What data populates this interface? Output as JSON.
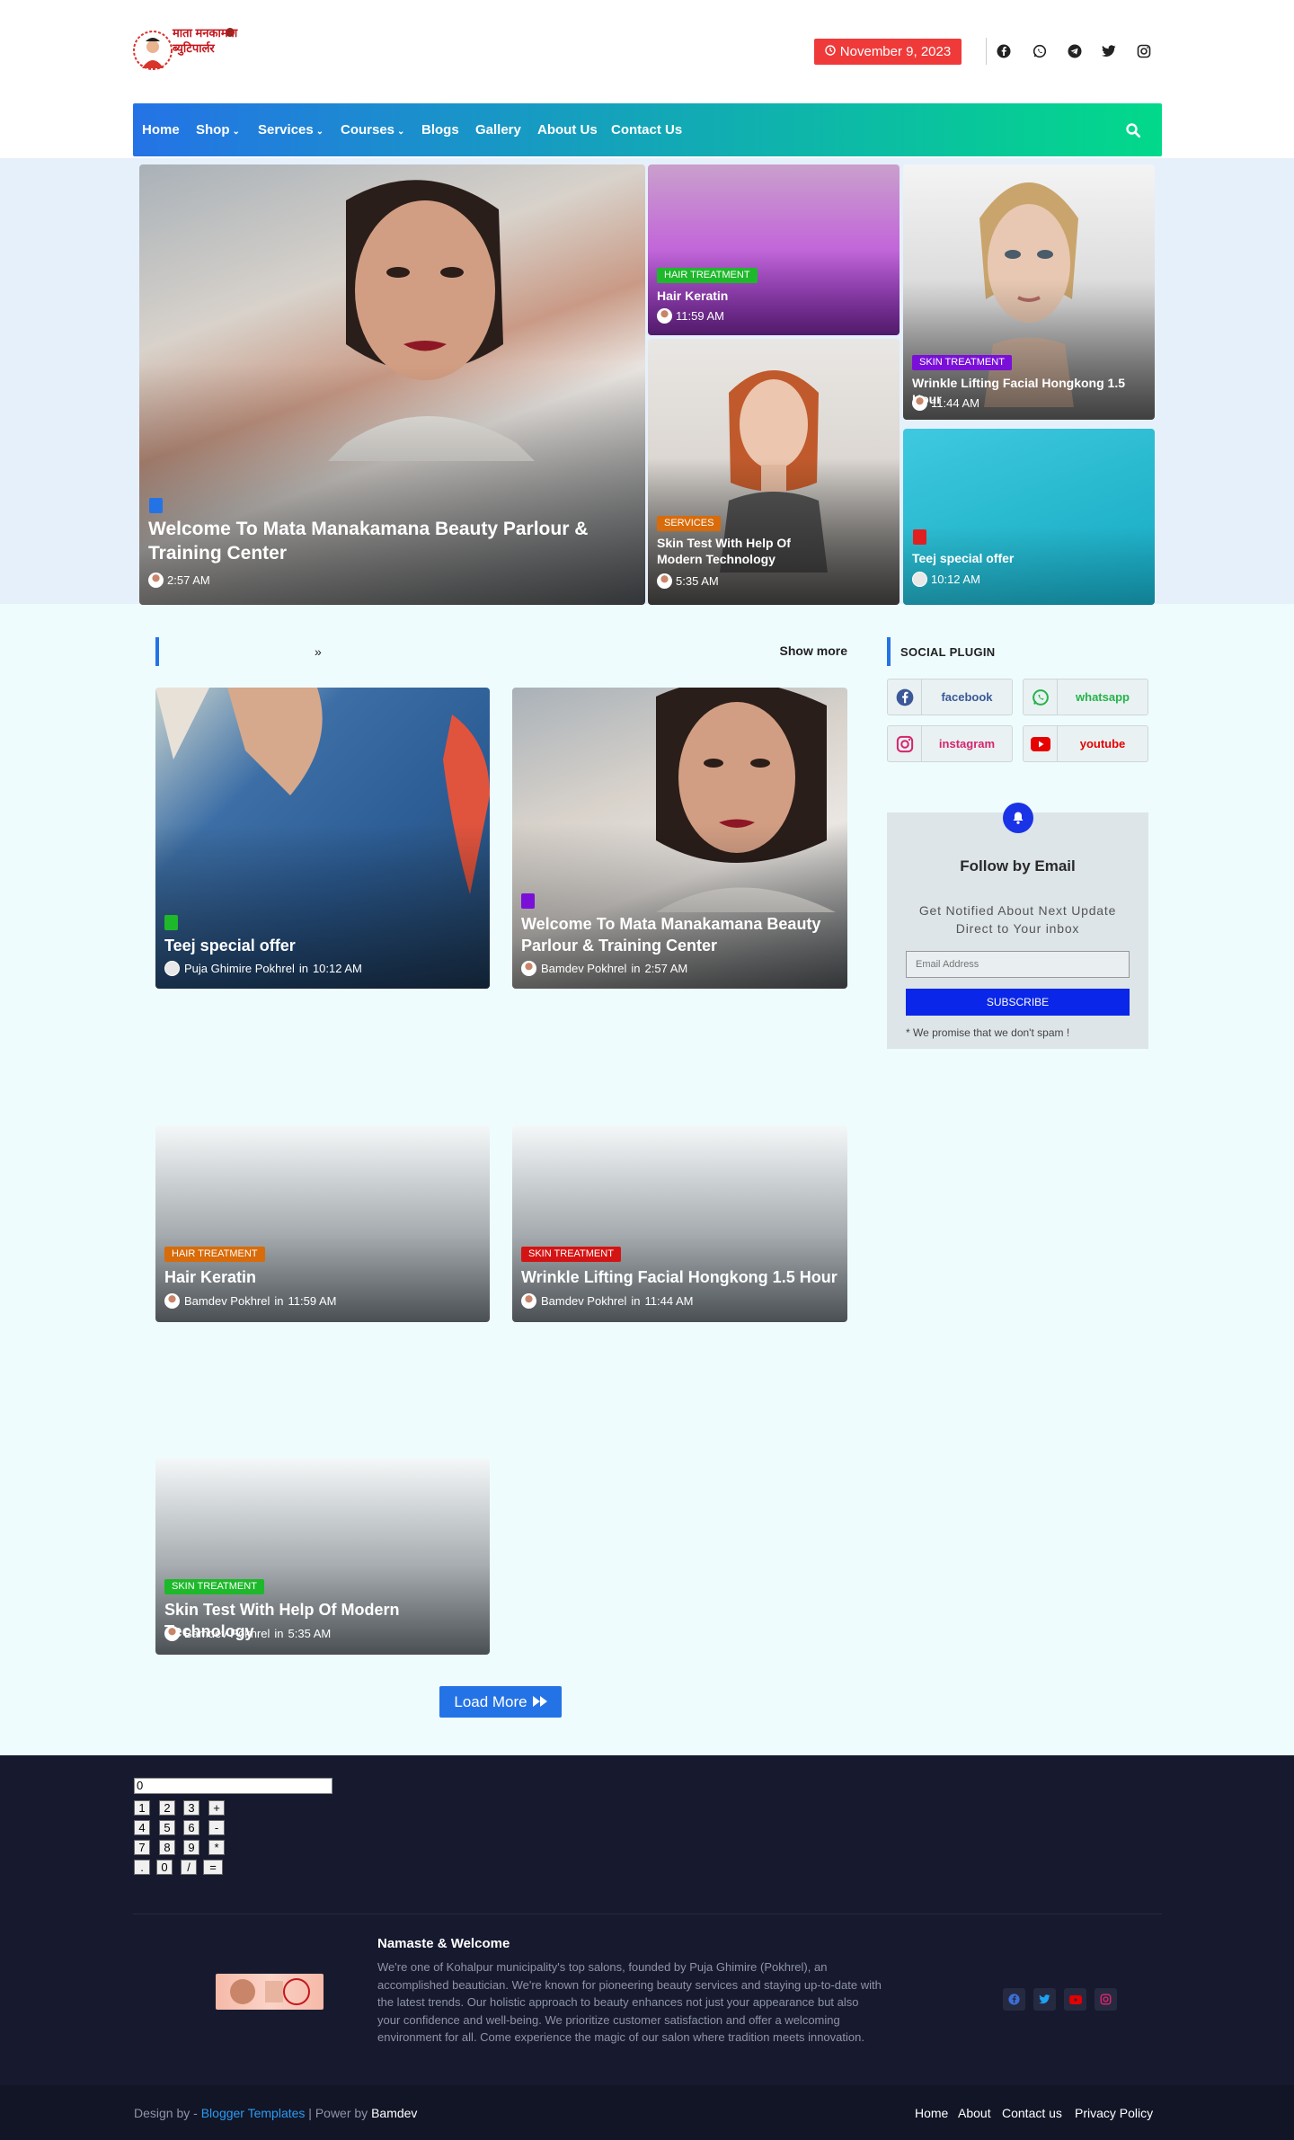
{
  "site": {
    "logo_text": "माता मनकामना ब्युटिपार्लर",
    "date": "November 9, 2023"
  },
  "header_social": [
    "facebook-icon",
    "whatsapp-icon",
    "telegram-icon",
    "twitter-icon",
    "instagram-icon"
  ],
  "nav": {
    "items": [
      {
        "label": "Home"
      },
      {
        "label": "Shop"
      },
      {
        "label": "Services"
      },
      {
        "label": "Courses"
      },
      {
        "label": "Blogs"
      },
      {
        "label": "Gallery"
      },
      {
        "label": "About Us"
      },
      {
        "label": "Contact Us"
      }
    ],
    "dropdown_caret": "⌄"
  },
  "hero": {
    "main": {
      "title": "Welcome To Mata Manakamana Beauty Parlour & Training Center",
      "time": "2:57 AM"
    },
    "t1": {
      "tag": "HAIR TREATMENT",
      "title": "Hair Keratin",
      "time": "11:59 AM"
    },
    "t2": {
      "tag": "SERVICES",
      "title": "Skin Test With Help Of Modern Technology",
      "time": "5:35 AM"
    },
    "t3": {
      "tag": "SKIN TREATMENT",
      "title": "Wrinkle Lifting Facial Hongkong 1.5 Hour",
      "time": "11:44 AM"
    },
    "t4": {
      "title": "Teej special offer",
      "time": "10:12 AM"
    }
  },
  "section": {
    "arrow": "»",
    "show_more": "Show more"
  },
  "posts": [
    {
      "title": "Teej special offer",
      "author": "Puja Ghimire Pokhrel",
      "in": "in",
      "time": "10:12 AM"
    },
    {
      "title": "Welcome To Mata Manakamana Beauty Parlour & Training Center",
      "author": "Bamdev Pokhrel",
      "in": "in",
      "time": "2:57 AM"
    },
    {
      "tag": "HAIR TREATMENT",
      "title": "Hair Keratin",
      "author": "Bamdev Pokhrel",
      "in": "in",
      "time": "11:59 AM"
    },
    {
      "tag": "SKIN TREATMENT",
      "title": "Wrinkle Lifting Facial Hongkong 1.5 Hour",
      "author": "Bamdev Pokhrel",
      "in": "in",
      "time": "11:44 AM"
    },
    {
      "tag": "SKIN TREATMENT",
      "title": "Skin Test With Help Of Modern Technology",
      "author": "Bamdev Pokhrel",
      "in": "in",
      "time": "5:35 AM"
    }
  ],
  "load_more": "Load More",
  "sidebar": {
    "title": "SOCIAL PLUGIN",
    "buttons": [
      {
        "label": "facebook",
        "color": "#3b5998"
      },
      {
        "label": "whatsapp",
        "color": "#25b34a"
      },
      {
        "label": "instagram",
        "color": "#d6246d"
      },
      {
        "label": "youtube",
        "color": "#e60000"
      }
    ],
    "follow": {
      "title": "Follow by Email",
      "desc": "Get Notified About Next Update Direct to Your inbox",
      "placeholder": "Email Address",
      "button": "SUBSCRIBE",
      "note": "* We promise that we don't spam !"
    }
  },
  "calculator": {
    "display": "0",
    "keys": [
      [
        "1",
        "2",
        "3",
        "+"
      ],
      [
        "4",
        "5",
        "6",
        "-"
      ],
      [
        "7",
        "8",
        "9",
        "*"
      ],
      [
        ".",
        "0",
        "/",
        "="
      ]
    ]
  },
  "footer": {
    "title": "Namaste & Welcome",
    "text": "We're one of Kohalpur municipality's top salons, founded by Puja Ghimire (Pokhrel), an accomplished beautician. We're known for pioneering beauty services and staying up-to-date with the latest trends. Our holistic approach to beauty enhances not just your appearance but also your confidence and well-being. We prioritize customer satisfaction and offer a welcoming environment for all. Come experience the magic of our salon where tradition meets innovation.",
    "credit": {
      "prefix": "Design by - ",
      "link": "Blogger Templates",
      "mid": " | Power by ",
      "owner": "Bamdev"
    },
    "menu": [
      "Home",
      "About",
      "Contact us",
      "Privacy Policy"
    ]
  },
  "colors": {
    "accent": "#2473e6",
    "accent2": "#02d98a",
    "date_badge": "#f03a3a",
    "footer_bg": "#171a2e"
  }
}
